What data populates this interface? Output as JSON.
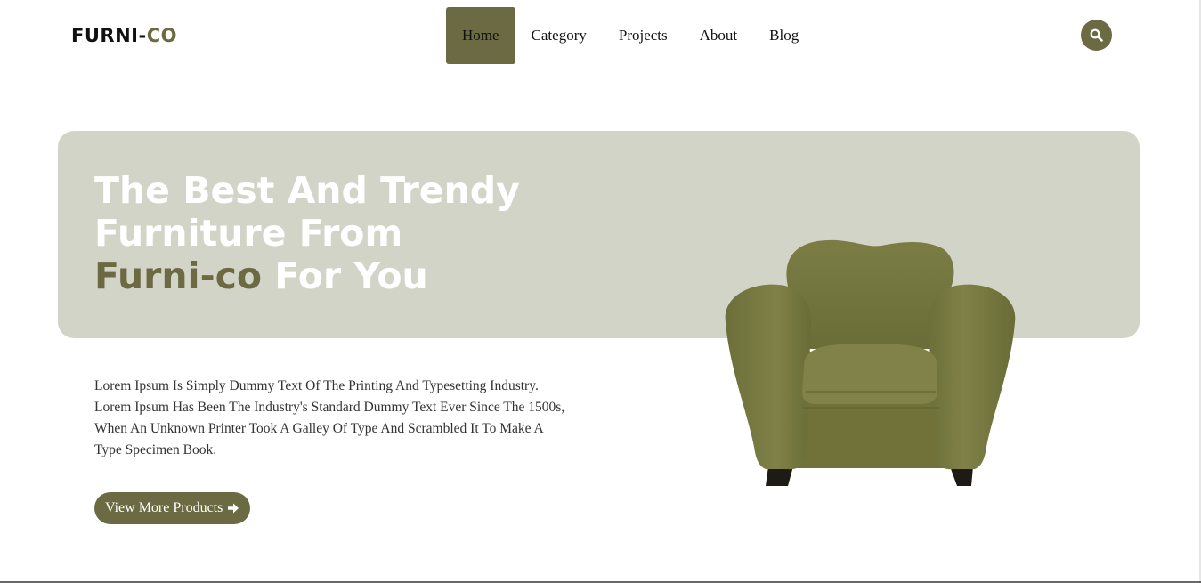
{
  "logo": {
    "main": "FURNI-",
    "accent": "CO"
  },
  "nav": [
    {
      "label": "Home",
      "active": true
    },
    {
      "label": "Category",
      "active": false
    },
    {
      "label": "Projects",
      "active": false
    },
    {
      "label": "About",
      "active": false
    },
    {
      "label": "Blog",
      "active": false
    }
  ],
  "search": {
    "icon": "search-icon"
  },
  "hero": {
    "line1": "The Best And Trendy",
    "line2": "Furniture From",
    "brand": "Furni-co",
    "line3_rest": " For You",
    "description": "Lorem Ipsum Is Simply Dummy Text Of The Printing And Typesetting Industry. Lorem Ipsum Has Been The Industry's Standard Dummy Text Ever Since The 1500s, When An Unknown Printer Took A Galley Of Type And Scrambled It To Make A Type Specimen Book.",
    "cta_label": "View More Products",
    "cta_icon": "arrow-right-icon",
    "image": "green-armchair"
  },
  "colors": {
    "accent": "#6b6a42",
    "panel": "#d3d4c8",
    "chair": "#75773f"
  }
}
